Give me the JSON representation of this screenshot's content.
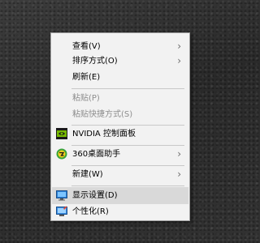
{
  "context_menu": {
    "items": [
      {
        "label": "查看(V)",
        "submenu_arrow": "›"
      },
      {
        "label": "排序方式(O)",
        "submenu_arrow": "›"
      },
      {
        "label": "刷新(E)"
      },
      {
        "label": "粘贴(P)",
        "disabled": true
      },
      {
        "label": "粘贴快捷方式(S)",
        "disabled": true
      },
      {
        "label": "NVIDIA 控制面板",
        "icon": "nvidia-icon"
      },
      {
        "label": "360桌面助手",
        "icon": "360-assistant-icon",
        "submenu_arrow": "›"
      },
      {
        "label": "新建(W)",
        "submenu_arrow": "›"
      },
      {
        "label": "显示设置(D)",
        "icon": "display-settings-icon",
        "highlighted": true
      },
      {
        "label": "个性化(R)",
        "icon": "personalize-icon"
      }
    ]
  },
  "colors": {
    "menu_background": "#f2f2f2",
    "highlight": "#d9d9d9",
    "disabled_text": "#8d8d8d",
    "nvidia_green": "#76b900"
  }
}
